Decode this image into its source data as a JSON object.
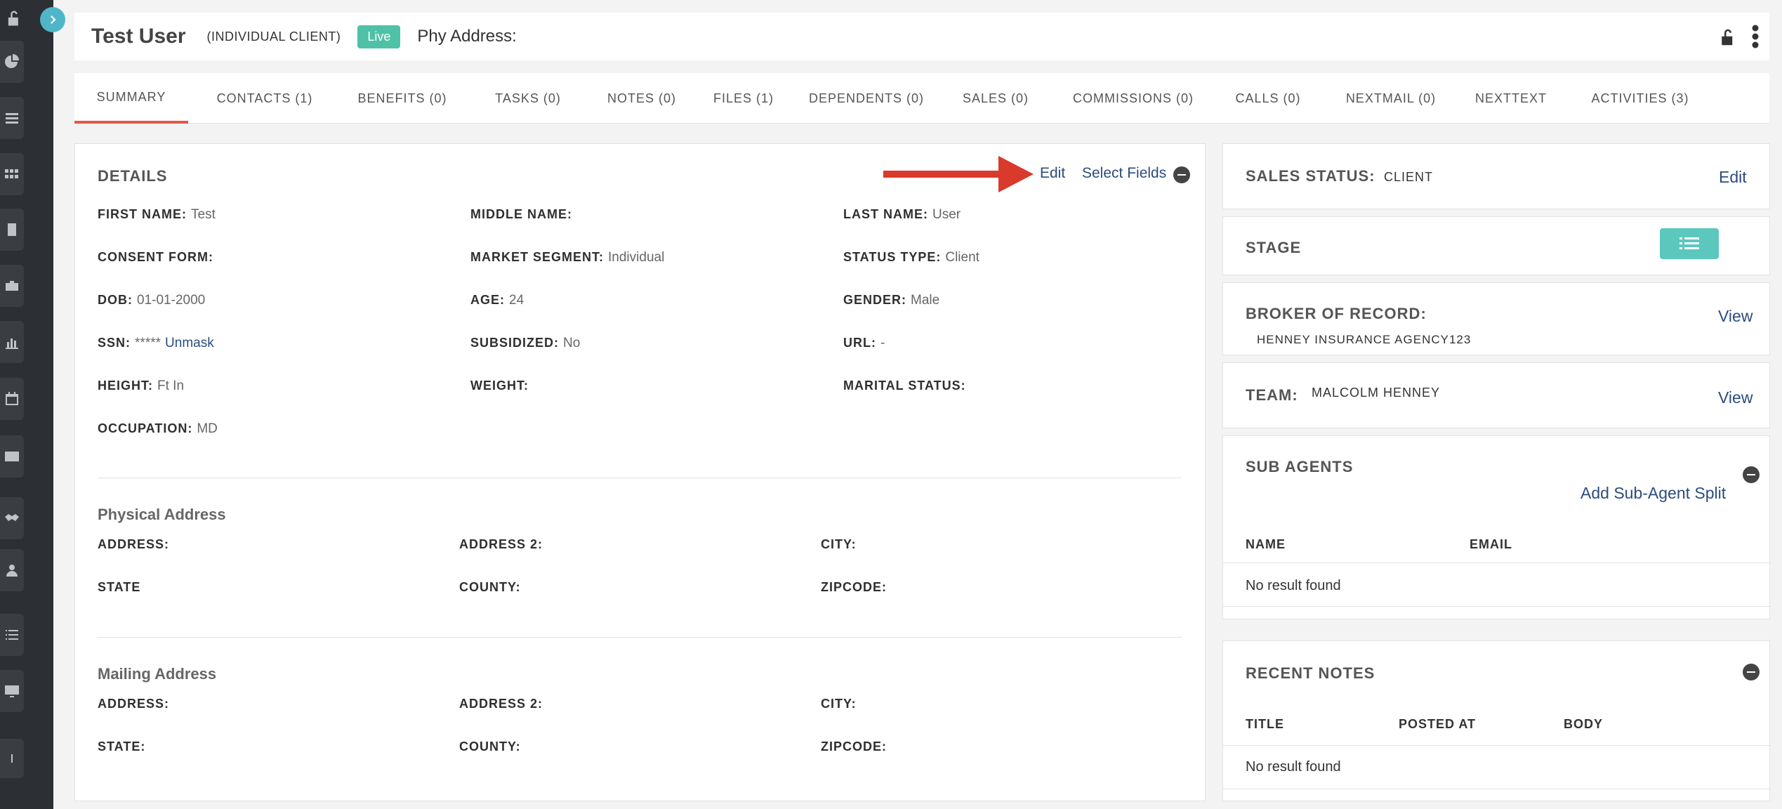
{
  "header": {
    "user_name": "Test User",
    "client_type": "(INDIVIDUAL CLIENT)",
    "status_badge": "Live",
    "phy_address_label": "Phy Address:"
  },
  "tabs": [
    {
      "label": "SUMMARY"
    },
    {
      "label": "CONTACTS (1)"
    },
    {
      "label": "BENEFITS (0)"
    },
    {
      "label": "TASKS (0)"
    },
    {
      "label": "NOTES (0)"
    },
    {
      "label": "FILES (1)"
    },
    {
      "label": "DEPENDENTS (0)"
    },
    {
      "label": "SALES (0)"
    },
    {
      "label": "COMMISSIONS (0)"
    },
    {
      "label": "CALLS (0)"
    },
    {
      "label": "NEXTMAIL (0)"
    },
    {
      "label": "NEXTTEXT"
    },
    {
      "label": "ACTIVITIES (3)"
    }
  ],
  "details": {
    "title": "DETAILS",
    "edit_label": "Edit",
    "select_fields_label": "Select Fields",
    "fields": {
      "first_name": {
        "label": "FIRST NAME:",
        "value": "Test"
      },
      "middle_name": {
        "label": "MIDDLE NAME:",
        "value": ""
      },
      "last_name": {
        "label": "LAST NAME:",
        "value": "User"
      },
      "consent_form": {
        "label": "CONSENT FORM:",
        "value": ""
      },
      "market_segment": {
        "label": "MARKET SEGMENT:",
        "value": "Individual"
      },
      "status_type": {
        "label": "STATUS TYPE:",
        "value": "Client"
      },
      "dob": {
        "label": "DOB:",
        "value": "01-01-2000"
      },
      "age": {
        "label": "AGE:",
        "value": "24"
      },
      "gender": {
        "label": "GENDER:",
        "value": "Male"
      },
      "ssn": {
        "label": "SSN:",
        "value": "*****",
        "unmask": "Unmask"
      },
      "subsidized": {
        "label": "SUBSIDIZED:",
        "value": "No"
      },
      "url": {
        "label": "URL:",
        "value": "-"
      },
      "height": {
        "label": "HEIGHT:",
        "value": "Ft In"
      },
      "weight": {
        "label": "WEIGHT:",
        "value": ""
      },
      "marital_status": {
        "label": "MARITAL STATUS:",
        "value": ""
      },
      "occupation": {
        "label": "OCCUPATION:",
        "value": "MD"
      }
    },
    "physical_address": {
      "title": "Physical Address",
      "address": "ADDRESS:",
      "address2": "ADDRESS 2:",
      "city": "CITY:",
      "state": "STATE",
      "county": "COUNTY:",
      "zipcode": "ZIPCODE:"
    },
    "mailing_address": {
      "title": "Mailing Address",
      "address": "ADDRESS:",
      "address2": "ADDRESS 2:",
      "city": "CITY:",
      "state": "STATE:",
      "county": "COUNTY:",
      "zipcode": "ZIPCODE:"
    }
  },
  "right": {
    "sales_status": {
      "label": "SALES STATUS:",
      "value": "CLIENT",
      "edit": "Edit"
    },
    "stage": {
      "label": "STAGE"
    },
    "broker": {
      "label": "BROKER OF RECORD:",
      "value": "HENNEY INSURANCE AGENCY123",
      "view": "View"
    },
    "team": {
      "label": "TEAM:",
      "value": "MALCOLM HENNEY",
      "view": "View"
    },
    "sub_agents": {
      "label": "SUB AGENTS",
      "add_link": "Add Sub-Agent Split",
      "col_name": "NAME",
      "col_email": "EMAIL",
      "empty": "No result found"
    },
    "recent_notes": {
      "label": "RECENT NOTES",
      "col_title": "TITLE",
      "col_posted": "POSTED AT",
      "col_body": "BODY",
      "empty": "No result found"
    }
  },
  "sidebar": {
    "icons": [
      "lock-open-icon",
      "pie-chart-icon",
      "list-icon",
      "grid-icon",
      "book-icon",
      "briefcase-icon",
      "bar-chart-icon",
      "calendar-check-icon",
      "envelope-icon",
      "handshake-icon",
      "user-icon",
      "list-bullets-icon",
      "monitor-icon",
      "info-icon"
    ]
  },
  "colors": {
    "accent_teal": "#4fb6c9",
    "live_badge": "#4fc1a6",
    "active_tab": "#e4574a",
    "link": "#2b4c7e",
    "arrow": "#d93a2b"
  }
}
